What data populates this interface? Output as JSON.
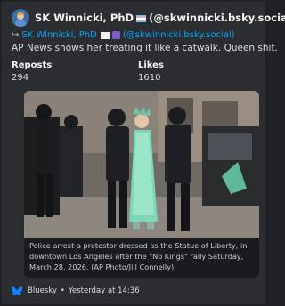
{
  "post": {
    "author_name": "SK Winnicki, PhD",
    "author_handle": "(@skwinnicki.bsky.social)",
    "reply_prefix_icon": "reply-arrow-icon",
    "reply_name": "SK Winnicki, PhD",
    "reply_handle": "(@skwinnicki.bsky.social)",
    "text": "AP News shows her treating it like a catwalk. Queen shit.",
    "reposts_label": "Reposts",
    "reposts_value": "294",
    "likes_label": "Likes",
    "likes_value": "1610"
  },
  "media": {
    "caption": "Police arrest a protestor dressed as the Statue of Liberty, in downtown Los Angeles after the \"No Kings\" rally Saturday, March 28, 2026. (AP Photo/Jill Connelly)"
  },
  "footer": {
    "source": "Bluesky",
    "timestamp": "Yesterday at 14:36",
    "separator": "•"
  },
  "colors": {
    "background": "#1f2124",
    "card": "#2b2d31",
    "link": "#00a8fc",
    "bluesky": "#1185fe"
  }
}
